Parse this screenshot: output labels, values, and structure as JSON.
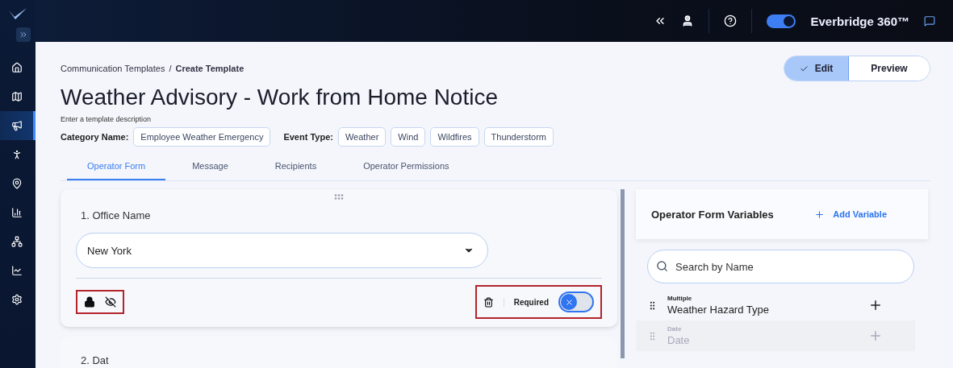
{
  "sidebar": {
    "items": [
      {
        "selected": false
      },
      {
        "selected": false
      },
      {
        "selected": true
      },
      {
        "selected": false
      },
      {
        "selected": false
      },
      {
        "selected": false
      },
      {
        "selected": false
      },
      {
        "selected": false
      },
      {
        "selected": false
      }
    ]
  },
  "top_bar": {
    "product_toggle_on": true,
    "product_name": "Everbridge 360™"
  },
  "breadcrumb": [
    "Communication Templates",
    "Create Template"
  ],
  "breadcrumb_separator": "/",
  "mode_switch": [
    {
      "label": "Edit",
      "selected": true
    },
    {
      "label": "Preview",
      "selected": false
    }
  ],
  "title": "Weather Advisory - Work from Home Notice",
  "description_placeholder": "Enter a template description",
  "category": {
    "label": "Category Name:",
    "tags": [
      "Employee Weather Emergency"
    ]
  },
  "event_type": {
    "label": "Event Type:",
    "tags": [
      "Weather",
      "Wind",
      "Wildfires",
      "Thunderstorm"
    ]
  },
  "tabs": [
    {
      "label": "Operator Form",
      "selected": true
    },
    {
      "label": "Message",
      "selected": false
    },
    {
      "label": "Recipients",
      "selected": false
    },
    {
      "label": "Operator Permissions",
      "selected": false
    }
  ],
  "form_fields": [
    {
      "label": "1. Office Name",
      "value": "New York",
      "required_label": "Required",
      "required": false
    },
    {
      "label": "2. Dat"
    }
  ],
  "variables_panel": {
    "title": "Operator Form Variables",
    "add_label": "Add Variable",
    "search_placeholder": "Search by Name",
    "items": [
      {
        "type": "Multiple",
        "name": "Weather Hazard Type",
        "disabled": false
      },
      {
        "type": "Date",
        "name": "Date",
        "disabled": true
      }
    ]
  }
}
